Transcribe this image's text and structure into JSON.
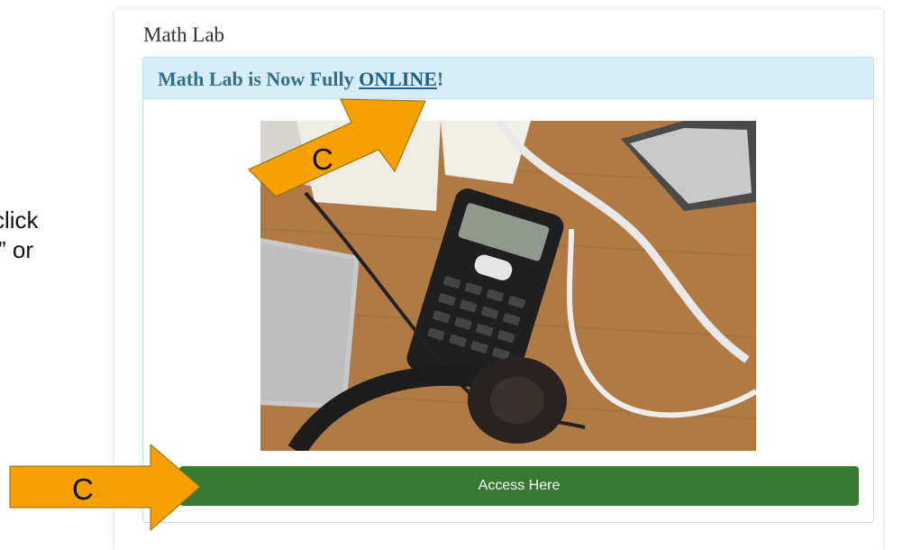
{
  "side_text": {
    "line1": "click",
    "line2": "” or"
  },
  "panel": {
    "title": "Math Lab"
  },
  "card": {
    "header_prefix": "Math Lab is Now Fully ",
    "header_link": "ONLINE",
    "header_suffix": "!",
    "button_label": "Access Here"
  },
  "annotations": {
    "arrow_top_label": "C",
    "arrow_bottom_label": "C"
  },
  "colors": {
    "arrow": "#f7a000",
    "button": "#387a34",
    "header_bg": "#d9edf7",
    "header_text": "#31708f"
  }
}
